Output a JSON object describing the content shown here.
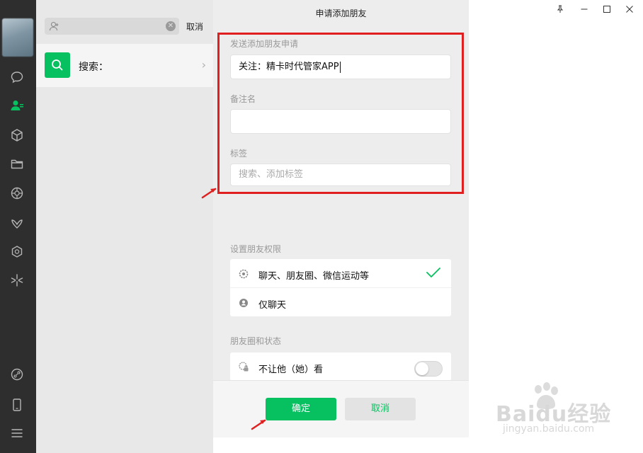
{
  "search": {
    "cancel_label": "取消"
  },
  "search_result": {
    "label": "搜索："
  },
  "dialog": {
    "title": "申请添加朋友",
    "request_section": {
      "label": "发送添加朋友申请",
      "value": "关注：精卡时代管家APP"
    },
    "remark_section": {
      "label": "备注名",
      "value": ""
    },
    "tag_section": {
      "label": "标签",
      "placeholder": "搜索、添加标签"
    },
    "permissions": {
      "label": "设置朋友权限",
      "options": [
        {
          "label": "聊天、朋友圈、微信运动等",
          "selected": true
        },
        {
          "label": "仅聊天",
          "selected": false
        }
      ]
    },
    "moments": {
      "label": "朋友圈和状态",
      "hide_my_moments_label": "不让他（她）看",
      "hide_my_moments_enabled": false
    },
    "confirm_label": "确定",
    "cancel_label": "取消"
  },
  "watermark": {
    "brand": "Baidu经验",
    "url": "jingyan.baidu.com"
  },
  "colors": {
    "accent": "#07c160",
    "highlight": "#e02020",
    "nav_bg": "#2e2e2e"
  },
  "icons": [
    "chat-icon",
    "contacts-icon",
    "cube-icon",
    "folder-icon",
    "moments-icon",
    "butterfly-icon",
    "gear-icon",
    "sparkle-icon",
    "link-icon",
    "phone-icon",
    "menu-icon",
    "pin-icon",
    "minimize-icon",
    "maximize-icon",
    "close-icon"
  ]
}
